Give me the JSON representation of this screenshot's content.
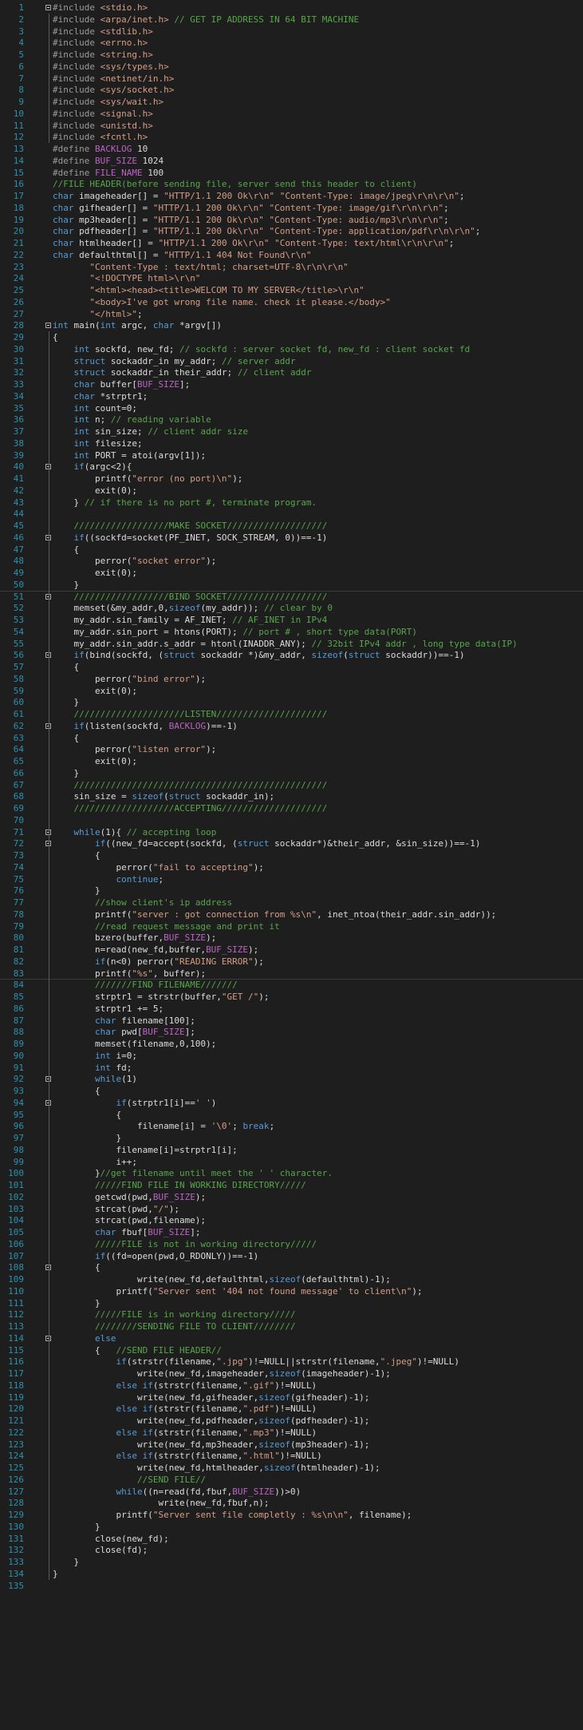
{
  "editor": {
    "lines": [
      "#include <stdio.h>",
      "#include <arpa/inet.h> // GET IP ADDRESS IN 64 BIT MACHINE",
      "#include <stdlib.h>",
      "#include <errno.h>",
      "#include <string.h>",
      "#include <sys/types.h>",
      "#include <netinet/in.h>",
      "#include <sys/socket.h>",
      "#include <sys/wait.h>",
      "#include <signal.h>",
      "#include <unistd.h>",
      "#include <fcntl.h>",
      "#define BACKLOG 10",
      "#define BUF_SIZE 1024",
      "#define FILE_NAME 100",
      "//FILE HEADER(before sending file, server send this header to client)",
      "char imageheader[] = \"HTTP/1.1 200 Ok\\r\\n\" \"Content-Type: image/jpeg\\r\\n\\r\\n\";",
      "char gifheader[] = \"HTTP/1.1 200 Ok\\r\\n\" \"Content-Type: image/gif\\r\\n\\r\\n\";",
      "char mp3header[] = \"HTTP/1.1 200 Ok\\r\\n\" \"Content-Type: audio/mp3\\r\\n\\r\\n\";",
      "char pdfheader[] = \"HTTP/1.1 200 Ok\\r\\n\" \"Content-Type: application/pdf\\r\\n\\r\\n\";",
      "char htmlheader[] = \"HTTP/1.1 200 Ok\\r\\n\" \"Content-Type: text/html\\r\\n\\r\\n\";",
      "char defaulthtml[] = \"HTTP/1.1 404 Not Found\\r\\n\"",
      "       \"Content-Type : text/html; charset=UTF-8\\r\\n\\r\\n\"",
      "       \"<!DOCTYPE html>\\r\\n\"",
      "       \"<html><head><title>WELCOM TO MY SERVER</title>\\r\\n\"",
      "       \"<body>I've got wrong file name. check it please.</body>\"",
      "       \"</html>\";",
      "int main(int argc, char *argv[])",
      "{",
      "    int sockfd, new_fd; // sockfd : server socket fd, new_fd : client socket fd",
      "    struct sockaddr_in my_addr; // server addr",
      "    struct sockaddr_in their_addr; // client addr",
      "    char buffer[BUF_SIZE];",
      "    char *strptr1;",
      "    int count=0;",
      "    int n; // reading variable",
      "    int sin_size; // client addr size",
      "    int filesize;",
      "    int PORT = atoi(argv[1]);",
      "    if(argc<2){",
      "        printf(\"error (no port)\\n\");",
      "        exit(0);",
      "    } // if there is no port #, terminate program.",
      "",
      "    //////////////////MAKE SOCKET///////////////////",
      "    if((sockfd=socket(PF_INET, SOCK_STREAM, 0))==-1)",
      "    {",
      "        perror(\"socket error\");",
      "        exit(0);",
      "    }",
      "    //////////////////BIND SOCKET///////////////////",
      "    memset(&my_addr,0,sizeof(my_addr)); // clear by 0",
      "    my_addr.sin_family = AF_INET; // AF_INET in IPv4",
      "    my_addr.sin_port = htons(PORT); // port # , short type data(PORT)",
      "    my_addr.sin_addr.s_addr = htonl(INADDR_ANY); // 32bit IPv4 addr , long type data(IP)",
      "    if(bind(sockfd, (struct sockaddr *)&my_addr, sizeof(struct sockaddr))==-1)",
      "    {",
      "        perror(\"bind error\");",
      "        exit(0);",
      "    }",
      "    /////////////////////LISTEN/////////////////////",
      "    if(listen(sockfd, BACKLOG)==-1)",
      "    {",
      "        perror(\"listen error\");",
      "        exit(0);",
      "    }",
      "    ////////////////////////////////////////////////",
      "    sin_size = sizeof(struct sockaddr_in);",
      "    ///////////////////ACCEPTING////////////////////",
      "",
      "    while(1){ // accepting loop",
      "        if((new_fd=accept(sockfd, (struct sockaddr*)&their_addr, &sin_size))==-1)",
      "        {",
      "            perror(\"fail to accepting\");",
      "            continue;",
      "        }",
      "        //show client's ip address",
      "        printf(\"server : got connection from %s\\n\", inet_ntoa(their_addr.sin_addr));",
      "        //read request message and print it",
      "        bzero(buffer,BUF_SIZE);",
      "        n=read(new_fd,buffer,BUF_SIZE);",
      "        if(n<0) perror(\"READING ERROR\");",
      "        printf(\"%s\", buffer);",
      "        ///////FIND FILENAME///////",
      "        strptr1 = strstr(buffer,\"GET /\");",
      "        strptr1 += 5;",
      "        char filename[100];",
      "        char pwd[BUF_SIZE];",
      "        memset(filename,0,100);",
      "        int i=0;",
      "        int fd;",
      "        while(1)",
      "        {",
      "            if(strptr1[i]==' ')",
      "            {",
      "                filename[i] = '\\0'; break;",
      "            }",
      "            filename[i]=strptr1[i];",
      "            i++;",
      "        }//get filename until meet the ' ' character.",
      "        /////FIND FILE IN WORKING DIRECTORY/////",
      "        getcwd(pwd,BUF_SIZE);",
      "        strcat(pwd,\"/\");",
      "        strcat(pwd,filename);",
      "        char fbuf[BUF_SIZE];",
      "        /////FILE is not in working directory/////",
      "        if((fd=open(pwd,O_RDONLY))==-1)",
      "        {",
      "                write(new_fd,defaulthtml,sizeof(defaulthtml)-1);",
      "            printf(\"Server sent '404 not found message' to client\\n\");",
      "        }",
      "        /////FILE is in working directory/////",
      "        ////////SENDING FILE TO CLIENT////////",
      "        else",
      "        {   //SEND FILE HEADER//",
      "            if(strstr(filename,\".jpg\")!=NULL||strstr(filename,\".jpeg\")!=NULL)",
      "                write(new_fd,imageheader,sizeof(imageheader)-1);",
      "            else if(strstr(filename,\".gif\")!=NULL)",
      "                write(new_fd,gifheader,sizeof(gifheader)-1);",
      "            else if(strstr(filename,\".pdf\")!=NULL)",
      "                write(new_fd,pdfheader,sizeof(pdfheader)-1);",
      "            else if(strstr(filename,\".mp3\")!=NULL)",
      "                write(new_fd,mp3header,sizeof(mp3header)-1);",
      "            else if(strstr(filename,\".html\")!=NULL)",
      "                write(new_fd,htmlheader,sizeof(htmlheader)-1);",
      "                //SEND FILE//",
      "            while((n=read(fd,fbuf,BUF_SIZE))>0)",
      "                    write(new_fd,fbuf,n);",
      "            printf(\"Server sent file completly : %s\\n\\n\", filename);",
      "        }",
      "        close(new_fd);",
      "        close(fd);",
      "    }",
      "}",
      ""
    ],
    "fold_markers": [
      1,
      28,
      40,
      46,
      51,
      56,
      62,
      71,
      72,
      92,
      94,
      108,
      114
    ],
    "colors": {
      "background": "#1e1e1e",
      "line_number": "#2b91af",
      "keyword": "#569cd6",
      "string": "#d69d85",
      "comment": "#57a64a",
      "macro": "#bd63c5",
      "text": "#dcdcdc"
    }
  }
}
